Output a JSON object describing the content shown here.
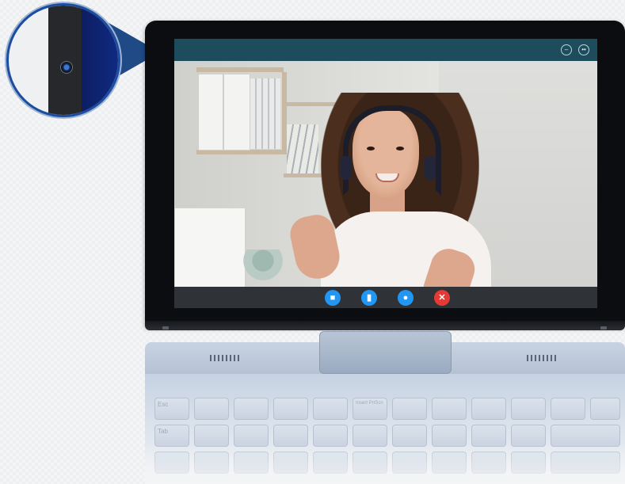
{
  "app": {
    "type": "video-call",
    "title_bar_color": "#1d4d5c",
    "window_controls": [
      {
        "name": "minimize-icon",
        "glyph": "–"
      },
      {
        "name": "fullscreen-icon",
        "glyph": "••"
      }
    ]
  },
  "call_controls": [
    {
      "name": "video-camera-button",
      "icon": "video-camera-icon",
      "glyph": "■",
      "color": "#2196f3"
    },
    {
      "name": "signal-stats-button",
      "icon": "signal-bars-icon",
      "glyph": "▮",
      "color": "#2196f3"
    },
    {
      "name": "chat-button",
      "icon": "chat-bubble-icon",
      "glyph": "●",
      "color": "#2196f3"
    },
    {
      "name": "end-call-button",
      "icon": "close-icon",
      "glyph": "✕",
      "color": "#e53935"
    }
  ],
  "keyboard": {
    "row1": [
      "Esc",
      "",
      "",
      "",
      "",
      "Insert PrtScn",
      "",
      "",
      "",
      "",
      "",
      "",
      ""
    ],
    "row2": [
      "Tab",
      "",
      "",
      "",
      "",
      "",
      "",
      "",
      "",
      "",
      "",
      ""
    ],
    "row3": [
      "",
      "",
      "",
      "",
      "",
      "",
      "",
      "",
      "",
      "",
      ""
    ]
  },
  "callout": {
    "subject": "webcam-lens",
    "accent_color": "#1c4da0"
  }
}
